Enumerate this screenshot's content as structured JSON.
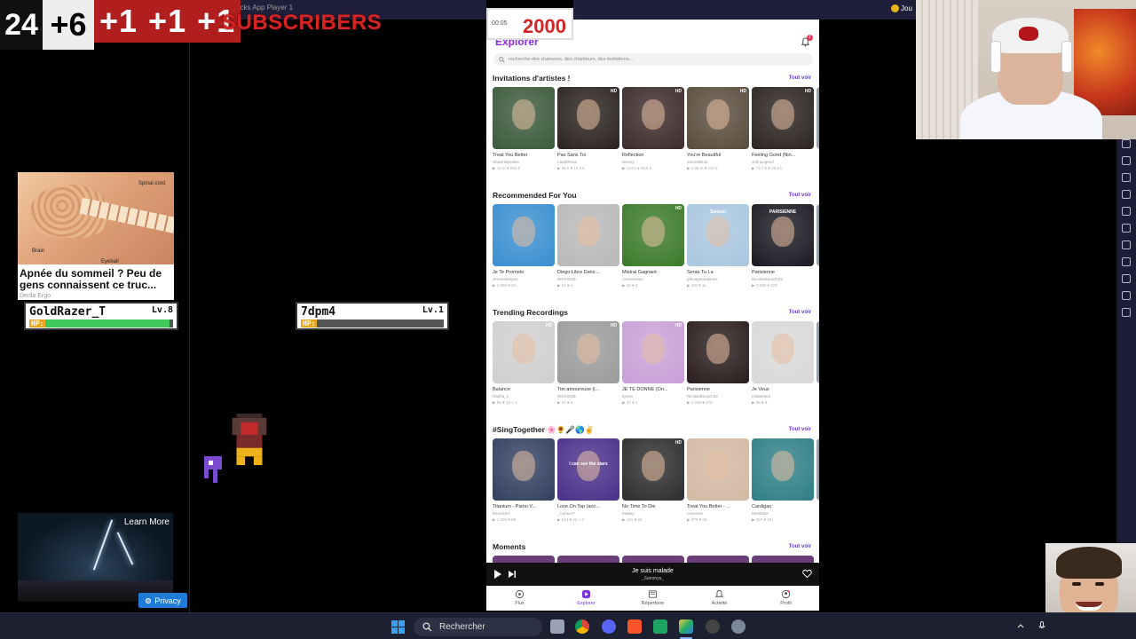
{
  "overlay": {
    "total_count": "24",
    "plus_six": "+6",
    "plus_ones": [
      "+1",
      "+1",
      "+1"
    ],
    "subscribers_label": "SUBSCRIBERS",
    "goal_number": "2000",
    "goal_small": "00:05",
    "title_strip": "eStacks App Player 1"
  },
  "left_panel": {
    "ad_title": "Apnée du sommeil ? Peu de gens connaissent ce truc...",
    "ad_source": "Derila Ergo",
    "ad_labels": {
      "spinal": "Spinal cord",
      "brain": "Brain",
      "eyeball": "Eyeball"
    },
    "players": [
      {
        "name": "GoldRazer_T",
        "level": "Lv.8",
        "hp_label": "HP:",
        "hp_fraction": 0.97
      },
      {
        "name": "7dpm4",
        "level": "Lv.1",
        "hp_label": "HP:",
        "hp_fraction": 0.0
      }
    ],
    "learn_more": "Learn More",
    "privacy": "Privacy"
  },
  "top_right_badge": "Jou",
  "app": {
    "title": "Explorer",
    "notification_count": "1",
    "search_placeholder": "recherche des chansons, des chanteurs, des invitations...",
    "see_all": "Tout voir",
    "sections": [
      {
        "title": "Invitations d'artistes !",
        "cards": [
          {
            "title": "Treat You Better",
            "user": "ShawnMendes",
            "stats": "▶ 12 m   ♥ 593 k",
            "badge": "",
            "color": "#3b5a3b"
          },
          {
            "title": "Pas Sans Toi",
            "user": "LarahRose",
            "stats": "▶ 99 k   ♥ 15,2 k",
            "badge": "HD",
            "color": "#2a2320"
          },
          {
            "title": "Reflection",
            "user": "Disney",
            "stats": "▶ 144 k   ♥ 25,5 k",
            "badge": "HD",
            "color": "#3c2b2a"
          },
          {
            "title": "You're Beautiful",
            "user": "JamesBlunt",
            "stats": "▶ 2,06 m   ♥ 107 k",
            "badge": "HD",
            "color": "#5a4c3c"
          },
          {
            "title": "Feeling Good (Nin...",
            "user": "JohnLegend",
            "stats": "▶ 74,7 k   ♥ 25,9 k",
            "badge": "HD",
            "color": "#2b2420"
          }
        ]
      },
      {
        "title": "Recommended For You",
        "cards": [
          {
            "title": "Je Te Promets",
            "user": "Jeremiebayart",
            "stats": "▶ 1 260   ♥ 43",
            "badge": "",
            "color": "#3a8ed0"
          },
          {
            "title": "Diego Libre Dans ...",
            "user": "NIKKISSB",
            "stats": "▶ 14   ♥ 4",
            "badge": "",
            "color": "#b8b8b8"
          },
          {
            "title": "Mistral Gagnant",
            "user": "AureeMusic",
            "stats": "▶ 12   ♥ 3",
            "badge": "HD",
            "color": "#3c7a2a"
          },
          {
            "title": "Seras Tu La",
            "user": "gfeoagneeatimes",
            "stats": "▶ 110   ♥ 11",
            "badge": "",
            "color": "#a9c6e0"
          },
          {
            "title": "Parisienne",
            "user": "NicolasBousch33",
            "stats": "▶ 3 036   ♥ 379",
            "badge": "",
            "color": "#1b1a22"
          }
        ]
      },
      {
        "title": "Trending Recordings",
        "cards": [
          {
            "title": "Balance",
            "user": "Rapha_L",
            "stats": "▶ 56   ♥ 12   ⤷ 1",
            "badge": "HD",
            "color": "#cfcfcf"
          },
          {
            "title": "Ton amoureuse (l...",
            "user": "NIKKISSB",
            "stats": "▶ 22   ♥ 5",
            "badge": "HD",
            "color": "#9b9b9b"
          },
          {
            "title": "JE TE DONNE (Ori...",
            "user": "ejeem",
            "stats": "▶ 37   ♥ 3",
            "badge": "HD",
            "color": "#c8a0d8"
          },
          {
            "title": "Parisienne",
            "user": "NicolasBousch33",
            "stats": "▶ 3 036   ♥ 379",
            "badge": "",
            "color": "#2a1d1d"
          },
          {
            "title": "Je Veux",
            "user": "nnlateneur",
            "stats": "▶ 85   ♥ 6",
            "badge": "",
            "color": "#d8d8d8"
          }
        ]
      },
      {
        "title": "#SingTogether 🌸🌻🎤🌎✌",
        "cards": [
          {
            "title": "Titanium - Piano V...",
            "user": "Etuvolonz",
            "stats": "▶ 1 026   ♥ 88",
            "badge": "",
            "color": "#324060"
          },
          {
            "title": "Love On Top (aco...",
            "user": "_ConnorT",
            "stats": "▶ 614   ♥ 22   ⤷ 4",
            "badge": "",
            "color": "#4a2f8a"
          },
          {
            "title": "No Time To Die",
            "user": "Mattey",
            "stats": "▶ 421   ♥ 84",
            "badge": "HD",
            "color": "#2d2d2d"
          },
          {
            "title": "Treat You Better - ...",
            "user": "Lexxious",
            "stats": "▶ 370   ♥ 33",
            "badge": "",
            "color": "#d2b9a3"
          },
          {
            "title": "Cardigan",
            "user": "MUSEBA",
            "stats": "▶ 257   ♥ 16",
            "badge": "",
            "color": "#2f7f86"
          }
        ]
      },
      {
        "title": "Moments",
        "cards": []
      }
    ],
    "thumb_texts": {
      "love_on_top": "I can see the stars",
      "seras_tu_la": "Sanson",
      "parisienne": "PARISIENNE"
    },
    "player": {
      "title": "Je suis malade",
      "artist": "_Sammya_"
    },
    "nav": [
      {
        "label": "Flux",
        "icon": "feed-icon"
      },
      {
        "label": "Explorer",
        "icon": "explore-icon"
      },
      {
        "label": "Répertoire",
        "icon": "songbook-icon"
      },
      {
        "label": "Activité",
        "icon": "bell-icon"
      },
      {
        "label": "Profil",
        "icon": "profile-icon"
      }
    ],
    "active_nav": "Explorer"
  },
  "taskbar": {
    "search_label": "Rechercher"
  },
  "colors": {
    "accent": "#8a2be2",
    "overlay_red": "#d62323",
    "hp_green": "#3fc95b",
    "hp_orange": "#e8a61b"
  }
}
